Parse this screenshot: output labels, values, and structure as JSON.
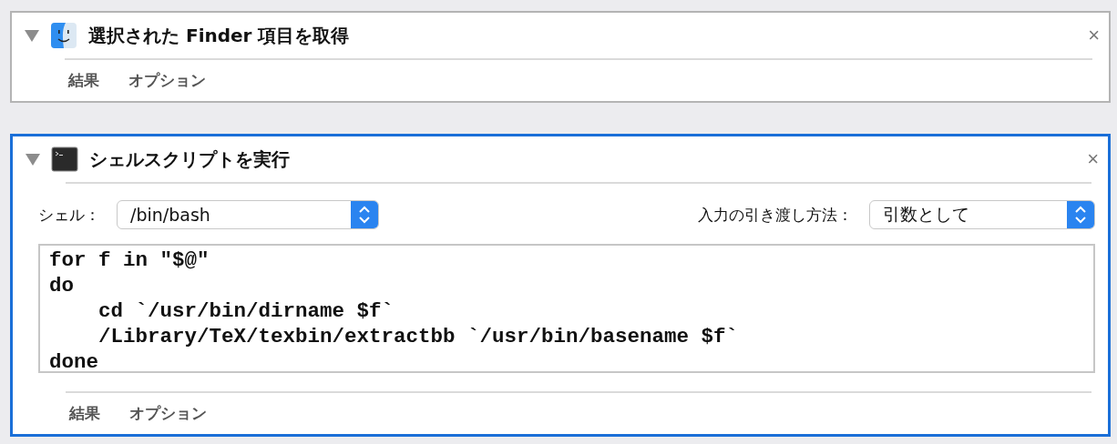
{
  "actions": [
    {
      "kind": "finder",
      "close": "×",
      "title": "選択された Finder 項目を取得",
      "selected": false,
      "expanded": true,
      "tabs": [
        "結果",
        "オプション"
      ]
    },
    {
      "kind": "terminal",
      "close": "×",
      "title": "シェルスクリプトを実行",
      "selected": true,
      "expanded": true,
      "settings": [
        {
          "label": "シェル：",
          "value": "/bin/bash"
        },
        {
          "label": "入力の引き渡し方法：",
          "value": "引数として"
        }
      ],
      "script": [
        "for f in \"$@\"",
        "do",
        "    cd `/usr/bin/dirname $f`",
        "    /Library/TeX/texbin/extractbb `/usr/bin/basename $f`",
        "done"
      ],
      "tabs": [
        "結果",
        "オプション"
      ]
    }
  ]
}
